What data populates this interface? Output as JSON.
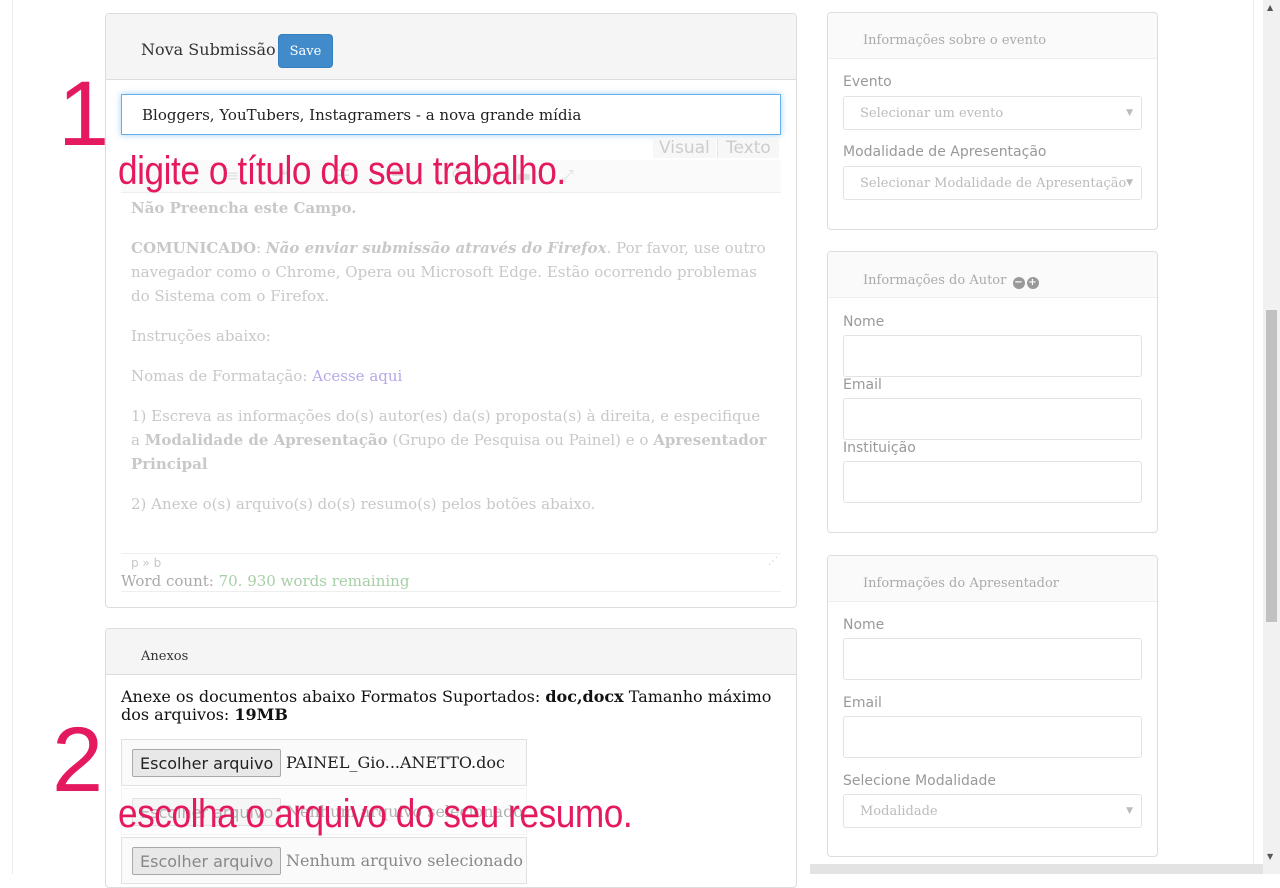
{
  "submission": {
    "header_title": "Nova Submissão",
    "save_label": "Save",
    "title_value": "Bloggers, YouTubers, Instagramers - a nova grande mídia",
    "tab_visual": "Visual",
    "tab_text": "Texto"
  },
  "editor": {
    "p1": "Não Preencha este Campo.",
    "p2_bold": "COMUNICADO",
    "p2_colon": ": ",
    "p2_link": "Não enviar submissão através do Firefox",
    "p2_rest": ". Por favor, use outro navegador como o Chrome, Opera ou Microsoft Edge. Estão ocorrendo problemas do Sistema com o Firefox.",
    "p3": "Instruções abaixo:",
    "p4_text": "Nomas de Formatação: ",
    "p4_link": "Acesse aqui",
    "p5_a": "1) Escreva as informações do(s) autor(es) da(s) proposta(s) à direita, e especifique a ",
    "p5_b": "Modalidade de Apresentação",
    "p5_c": " (Grupo de Pesquisa ou Painel) e o ",
    "p5_d": "Apresentador Principal",
    "p6": "2) Anexe o(s) arquivo(s) do(s) resumo(s) pelos botões abaixo.",
    "path": "p » b",
    "wordcount_label": "Word count: ",
    "wordcount_value": "70. 930 words remaining"
  },
  "annotations": {
    "step1_number": "1",
    "step1_text": "digite o título do seu trabalho.",
    "step2_number": "2",
    "step2_text": "escolha o arquivo do seu resumo."
  },
  "attachments": {
    "header_title": "Anexos",
    "desc_a": "Anexe os documentos abaixo Formatos Suportados: ",
    "desc_formats": "doc,docx",
    "desc_b": " Tamanho máximo dos arquivos: ",
    "desc_size": "19MB",
    "choose_label": "Escolher arquivo",
    "file1_name": "PAINEL_Gio...ANETTO.doc",
    "file3_name": "Nenhum arquivo selecionado"
  },
  "event_panel": {
    "title": "Informações sobre o evento",
    "event_label": "Evento",
    "event_placeholder": "Selecionar um evento",
    "modality_label": "Modalidade de Apresentação",
    "modality_placeholder": "Selecionar Modalidade de Apresentação"
  },
  "author_panel": {
    "title": "Informações do Autor",
    "name_label": "Nome",
    "email_label": "Email",
    "institution_label": "Instituição"
  },
  "presenter_panel": {
    "title": "Informações do Apresentador",
    "name_label": "Nome",
    "email_label": "Email",
    "modality_label": "Selecione Modalidade",
    "modality_placeholder": "Modalidade"
  },
  "icons": {
    "minus": "minus-circle-icon",
    "plus": "plus-circle-icon"
  },
  "colors": {
    "accent": "#428bca",
    "annotation": "#e5195f",
    "focus": "#66afe9"
  }
}
